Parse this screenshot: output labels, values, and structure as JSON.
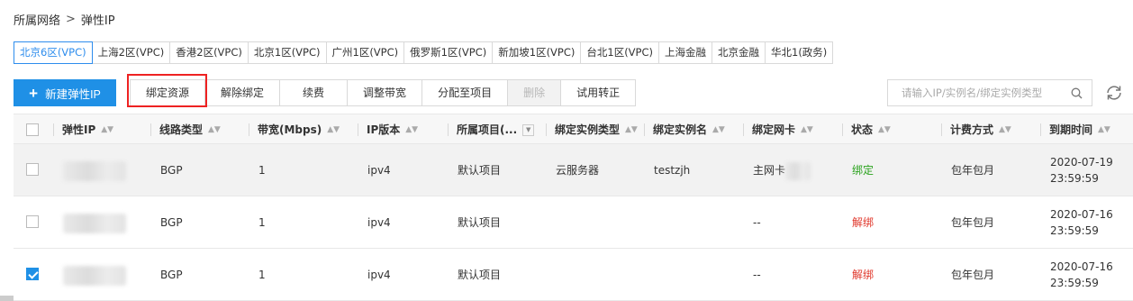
{
  "breadcrumb": {
    "parent": "所属网络",
    "separator": ">",
    "current": "弹性IP"
  },
  "regions": [
    {
      "label": "北京6区(VPC)",
      "active": true
    },
    {
      "label": "上海2区(VPC)"
    },
    {
      "label": "香港2区(VPC)"
    },
    {
      "label": "北京1区(VPC)"
    },
    {
      "label": "广州1区(VPC)"
    },
    {
      "label": "俄罗斯1区(VPC)"
    },
    {
      "label": "新加坡1区(VPC)"
    },
    {
      "label": "台北1区(VPC)"
    },
    {
      "label": "上海金融"
    },
    {
      "label": "北京金融"
    },
    {
      "label": "华北1(政务)"
    }
  ],
  "toolbar": {
    "new_label": "新建弹性IP",
    "bind": "绑定资源",
    "unbind": "解除绑定",
    "renew": "续费",
    "bandwidth": "调整带宽",
    "assign": "分配至项目",
    "delete": "删除",
    "trial": "试用转正"
  },
  "search": {
    "placeholder": "请输入IP/实例名/绑定实例类型"
  },
  "columns": {
    "ip": "弹性IP",
    "line": "线路类型",
    "bw": "带宽(Mbps)",
    "ver": "IP版本",
    "project": "所属项目(...",
    "bind_type": "绑定实例类型",
    "bind_name": "绑定实例名",
    "nic": "绑定网卡",
    "status": "状态",
    "billing": "计费方式",
    "expire": "到期时间"
  },
  "rows": [
    {
      "line": "BGP",
      "bw": "1",
      "ver": "ipv4",
      "project": "默认项目",
      "bind_type": "云服务器",
      "bind_name": "testzjh",
      "nic": "主网卡",
      "status": "绑定",
      "billing": "包年包月",
      "expire_date": "2020-07-19",
      "expire_time": "23:59:59",
      "checked": false
    },
    {
      "line": "BGP",
      "bw": "1",
      "ver": "ipv4",
      "project": "默认项目",
      "bind_type": "",
      "bind_name": "",
      "nic": "--",
      "status": "解绑",
      "billing": "包年包月",
      "expire_date": "2020-07-16",
      "expire_time": "23:59:59",
      "checked": false
    },
    {
      "line": "BGP",
      "bw": "1",
      "ver": "ipv4",
      "project": "默认项目",
      "bind_type": "",
      "bind_name": "",
      "nic": "--",
      "status": "解绑",
      "billing": "包年包月",
      "expire_date": "2020-07-16",
      "expire_time": "23:59:59",
      "checked": true
    }
  ],
  "colors": {
    "primary": "#1f90e6",
    "bound": "#2aa21d",
    "unbound": "#e0372b",
    "highlight": "#e22222"
  },
  "icons": {
    "search": "search-icon",
    "refresh": "refresh-icon",
    "sort": "sort-icon",
    "filter": "filter-icon",
    "add": "plus-icon"
  }
}
